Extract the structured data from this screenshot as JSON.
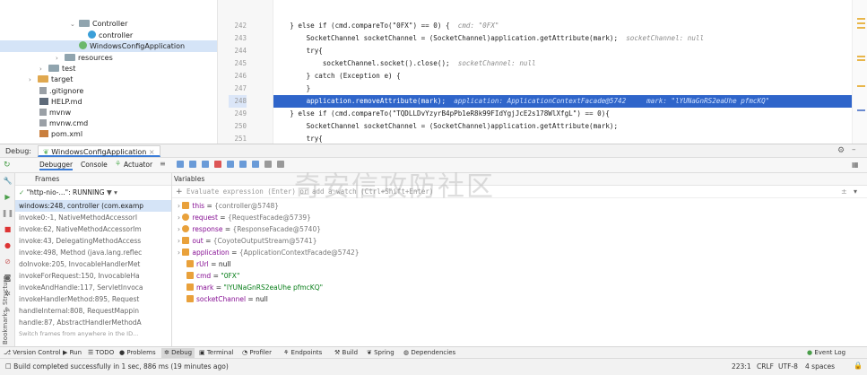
{
  "project_tree": {
    "items": [
      {
        "label": "Controller",
        "indent": 5
      },
      {
        "label": "controller",
        "indent": 7
      },
      {
        "label": "WindowsConfigApplication",
        "indent": 7
      },
      {
        "label": "resources",
        "indent": 4
      },
      {
        "label": "test",
        "indent": 3
      },
      {
        "label": "target",
        "indent": 1
      },
      {
        "label": ".gitignore",
        "indent": 2
      },
      {
        "label": "HELP.md",
        "indent": 2
      },
      {
        "label": "mvnw",
        "indent": 2
      },
      {
        "label": "mvnw.cmd",
        "indent": 2
      },
      {
        "label": "pom.xml",
        "indent": 2
      }
    ]
  },
  "editor": {
    "line_numbers": [
      "242",
      "243",
      "244",
      "245",
      "246",
      "247",
      "248",
      "249",
      "250",
      "251"
    ],
    "lines": [
      {
        "code": "    } else if (cmd.compareTo(\"0FX\") == 0) {",
        "hint": "cmd: \"0FX\""
      },
      {
        "code": "        SocketChannel socketChannel = (SocketChannel)application.getAttribute(mark);",
        "hint": "socketChannel: null"
      },
      {
        "code": "        try{",
        "hint": ""
      },
      {
        "code": "            socketChannel.socket().close();",
        "hint": "socketChannel: null"
      },
      {
        "code": "        } catch (Exception e) {",
        "hint": ""
      },
      {
        "code": "        }",
        "hint": ""
      },
      {
        "code": "        application.removeAttribute(mark);",
        "hint": "application: ApplicationContextFacade@5742     mark: \"lYUNaGnRS2eaUhe pfmcKQ\""
      },
      {
        "code": "    } else if (cmd.compareTo(\"TQDLLDvYzyrB4pPb1eR8k99FIdYgjJcE2s178WlXfgL\") == 0){",
        "hint": ""
      },
      {
        "code": "        SocketChannel socketChannel = (SocketChannel)application.getAttribute(mark);",
        "hint": ""
      },
      {
        "code": "        try{",
        "hint": ""
      }
    ]
  },
  "debug": {
    "label": "Debug:",
    "config_tab": "WindowsConfigApplication",
    "tabs": [
      "Debugger",
      "Console",
      "Actuator"
    ],
    "frames_header": "Frames",
    "variables_header": "Variables",
    "thread": "\"http-nio-...\": RUNNING",
    "frames": [
      "windows:248, controller (com.examp",
      "invoke0:-1, NativeMethodAccessorI",
      "invoke:62, NativeMethodAccessorIm",
      "invoke:43, DelegatingMethodAccess",
      "invoke:498, Method (java.lang.reflec",
      "doInvoke:205, InvocableHandlerMet",
      "invokeForRequest:150, InvocableHa",
      "invokeAndHandle:117, ServletInvoca",
      "invokeHandlerMethod:895, Request",
      "handleInternal:808, RequestMappin",
      "handle:87, AbstractHandlerMethodA"
    ],
    "frames_footer": "Switch frames from anywhere in the ID...",
    "eval_placeholder": "Evaluate expression (Enter) or add a watch (Ctrl+Shift+Enter)",
    "variables": [
      {
        "name": "this",
        "value": "{controller@5748}"
      },
      {
        "name": "request",
        "value": "{RequestFacade@5739}"
      },
      {
        "name": "response",
        "value": "{ResponseFacade@5740}"
      },
      {
        "name": "out",
        "value": "{CoyoteOutputStream@5741}"
      },
      {
        "name": "application",
        "value": "{ApplicationContextFacade@5742}"
      },
      {
        "name": "rUrl",
        "value": "null"
      },
      {
        "name": "cmd",
        "value": "\"0FX\""
      },
      {
        "name": "mark",
        "value": "\"lYUNaGnRS2eaUhe pfmcKQ\""
      },
      {
        "name": "socketChannel",
        "value": "null"
      }
    ]
  },
  "watermark": "奇安信攻防社区",
  "sidebar_labels": {
    "structure": "Structure",
    "bookmarks": "Bookmarks"
  },
  "bottom_tabs": [
    "Version Control",
    "Run",
    "TODO",
    "Problems",
    "Debug",
    "Terminal",
    "Profiler",
    "Endpoints",
    "Build",
    "Spring",
    "Dependencies"
  ],
  "event_log": "Event Log",
  "status": {
    "message": "Build completed successfully in 1 sec, 886 ms (19 minutes ago)",
    "position": "223:1",
    "line_sep": "CRLF",
    "encoding": "UTF-8",
    "indent": "4 spaces"
  },
  "colors": {
    "selection": "#2f65ca",
    "accent": "#3b9fd8"
  }
}
